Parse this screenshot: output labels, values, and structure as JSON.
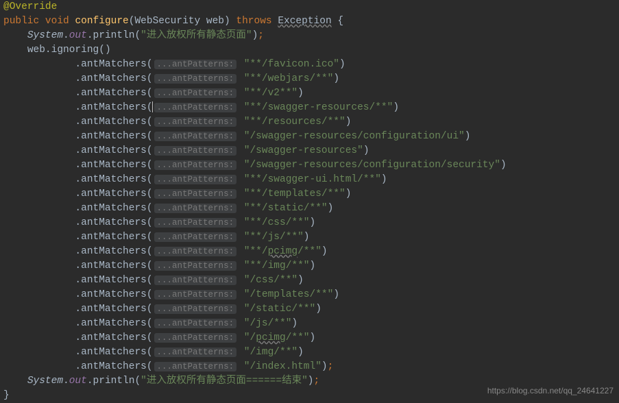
{
  "code": {
    "annotation": "@Override",
    "kw_public": "public",
    "kw_void": "void",
    "method_name": "configure",
    "param_type": "WebSecurity",
    "param_name": "web",
    "kw_throws": "throws",
    "exception": "Exception",
    "open_brace": " {",
    "sys": "System",
    "out": "out",
    "println": "println",
    "str_start": "\"进入放权所有静态页面\"",
    "str_end": "\"进入放权所有静态页面======结束\"",
    "web_obj": "web",
    "ignoring": "ignoring",
    "antMatchers": "antMatchers",
    "hint": "...antPatterns:",
    "closeparen_semi": ");",
    "closeparen": ")",
    "close_brace": "}",
    "matchers": [
      {
        "value": "\"**/favicon.ico\""
      },
      {
        "value": "\"**/webjars/**\""
      },
      {
        "value": "\"**/v2**\""
      },
      {
        "value": "\"**/swagger-resources/**\""
      },
      {
        "value": "\"**/resources/**\""
      },
      {
        "value": "\"/swagger-resources/configuration/ui\""
      },
      {
        "value": "\"/swagger-resources\""
      },
      {
        "value": "\"/swagger-resources/configuration/security\""
      },
      {
        "value": "\"**/swagger-ui.html/**\""
      },
      {
        "value": "\"**/templates/**\""
      },
      {
        "value": "\"**/static/**\""
      },
      {
        "value": "\"**/css/**\""
      },
      {
        "value": "\"**/js/**\""
      },
      {
        "value": "\"**/",
        "special": "pcimg",
        "after": "/**\""
      },
      {
        "value": "\"**/img/**\""
      },
      {
        "value": "\"/css/**\""
      },
      {
        "value": "\"/templates/**\""
      },
      {
        "value": "\"/static/**\""
      },
      {
        "value": "\"/js/**\""
      },
      {
        "value": "\"/",
        "special": "pcimg",
        "after": "/**\""
      },
      {
        "value": "\"/img/**\""
      },
      {
        "value": "\"/index.html\"",
        "is_last": true
      }
    ]
  },
  "watermark": "https://blog.csdn.net/qq_24641227"
}
